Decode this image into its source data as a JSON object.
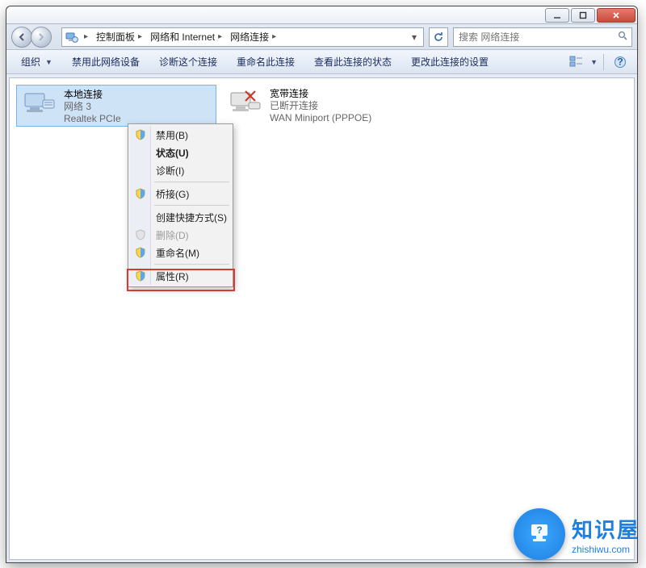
{
  "titlebar": {
    "min": "",
    "max": "",
    "close": ""
  },
  "breadcrumb": {
    "b1": "控制面板",
    "b2": "网络和 Internet",
    "b3": "网络连接"
  },
  "search": {
    "placeholder": "搜索 网络连接"
  },
  "toolbar": {
    "organize": "组织",
    "disable": "禁用此网络设备",
    "diagnose": "诊断这个连接",
    "rename": "重命名此连接",
    "status": "查看此连接的状态",
    "settings": "更改此连接的设置"
  },
  "items": [
    {
      "title": "本地连接",
      "sub1": "网络  3",
      "sub2": "Realtek PCIe"
    },
    {
      "title": "宽带连接",
      "sub1": "已断开连接",
      "sub2": "WAN Miniport (PPPOE)"
    }
  ],
  "menu": {
    "disable": "禁用(B)",
    "status": "状态(U)",
    "diag": "诊断(I)",
    "bridge": "桥接(G)",
    "shortcut": "创建快捷方式(S)",
    "delete": "删除(D)",
    "rename": "重命名(M)",
    "props": "属性(R)"
  },
  "watermark": {
    "title": "知识屋",
    "url": "zhishiwu.com"
  }
}
